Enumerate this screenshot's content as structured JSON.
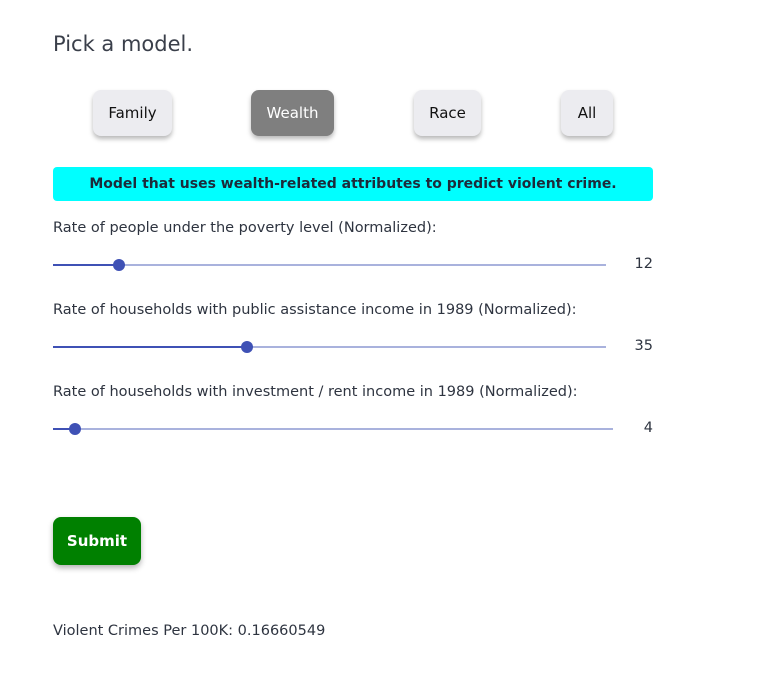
{
  "heading": "Pick a model.",
  "models": [
    {
      "label": "Family",
      "selected": false
    },
    {
      "label": "Wealth",
      "selected": true
    },
    {
      "label": "Race",
      "selected": false
    },
    {
      "label": "All",
      "selected": false
    }
  ],
  "banner": {
    "text": "Model that uses wealth-related attributes to predict violent crime.",
    "background": "#00ffff"
  },
  "sliders": [
    {
      "label": "Rate of people under the poverty level (Normalized):",
      "value": "12",
      "fraction": 0.12
    },
    {
      "label": "Rate of households with public assistance income in 1989 (Normalized):",
      "value": "35",
      "fraction": 0.35
    },
    {
      "label": "Rate of households with investment / rent income in 1989 (Normalized):",
      "value": "4",
      "fraction": 0.04
    }
  ],
  "submit": {
    "label": "Submit",
    "color": "#008000"
  },
  "result": {
    "text": "Violent Crimes Per 100K: 0.16660549"
  },
  "colors": {
    "slider_accent": "#3f51b5",
    "slider_rail": "#a9b2dd",
    "selected_button": "#7f7f7f"
  }
}
